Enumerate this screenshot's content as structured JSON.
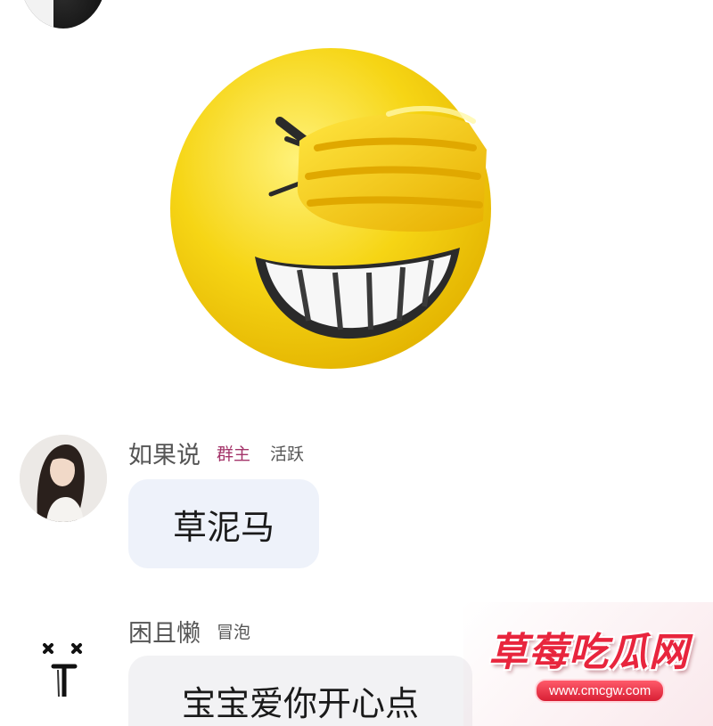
{
  "messages": [
    {
      "sender": "如果说",
      "tags": [
        "群主",
        "活跃"
      ],
      "text": "草泥马"
    },
    {
      "sender": "困且懒",
      "tags": [
        "冒泡"
      ],
      "text": "宝宝爱你开心点"
    }
  ],
  "sticker": {
    "icon": "laughing-covering-eyes-emoji-icon",
    "colors": {
      "face": "#f6d515",
      "shade": "#e0a800",
      "outline": "#2a2a2a"
    }
  },
  "watermark": {
    "title": "草莓吃瓜网",
    "url": "www.cmcgw.com"
  },
  "colors": {
    "bubble": "#eef2fa",
    "owner_tag": "#a4356a",
    "name": "#555555"
  }
}
